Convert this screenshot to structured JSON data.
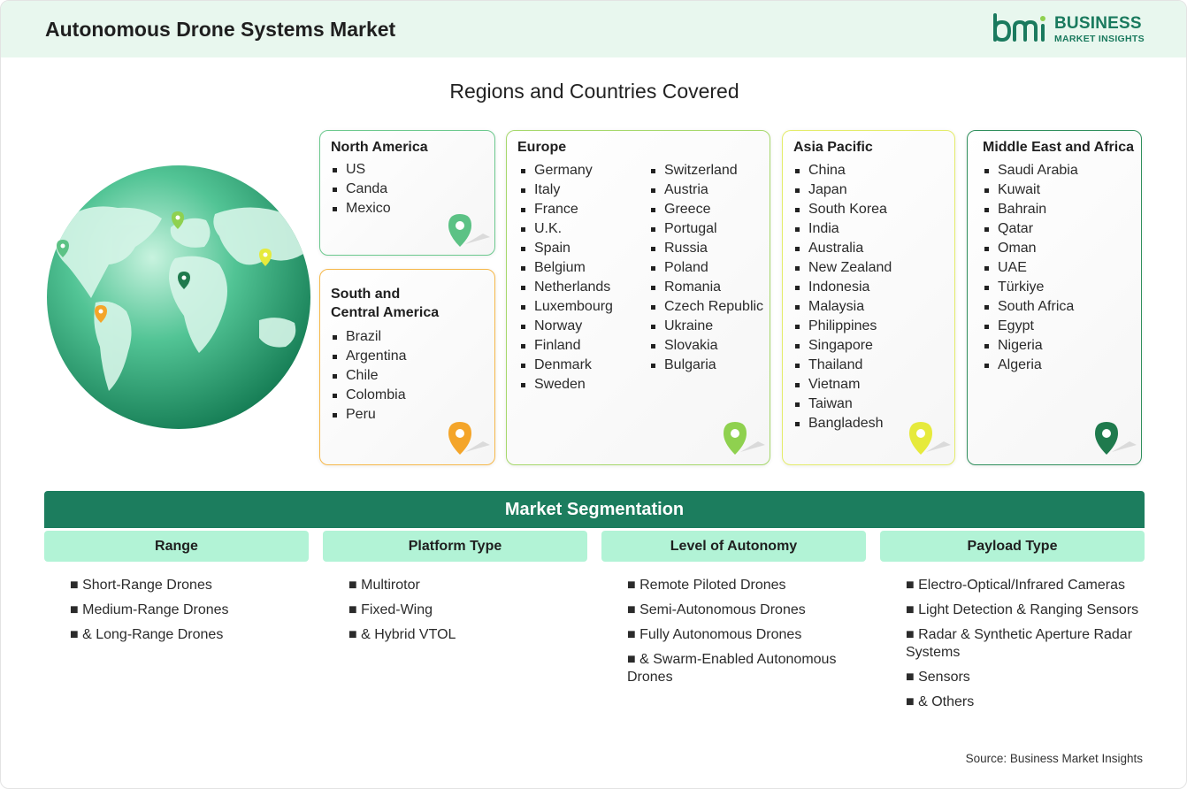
{
  "header": {
    "title": "Autonomous Drone Systems Market",
    "logo_line1": "BUSINESS",
    "logo_line2": "MARKET INSIGHTS"
  },
  "regions_title": "Regions and Countries Covered",
  "regions": {
    "north_america": {
      "title": "North America",
      "items": [
        "US",
        "Canda",
        "Mexico"
      ],
      "color": "#5cc285"
    },
    "south_central_america": {
      "title_line1": "South and",
      "title_line2": "Central America",
      "items": [
        "Brazil",
        "Argentina",
        "Chile",
        "Colombia",
        "Peru"
      ],
      "color": "#f4a52a"
    },
    "europe": {
      "title": "Europe",
      "col1": [
        "Germany",
        "Italy",
        "France",
        "U.K.",
        "Spain",
        "Belgium",
        "Netherlands",
        "Luxembourg",
        "Norway",
        "Finland",
        "Denmark",
        "Sweden"
      ],
      "col2": [
        "Switzerland",
        "Austria",
        "Greece",
        "Portugal",
        "Russia",
        "Poland",
        "Romania",
        "Czech Republic",
        "Ukraine",
        "Slovakia",
        "Bulgaria"
      ],
      "color": "#8fd14f"
    },
    "asia_pacific": {
      "title": "Asia Pacific",
      "items": [
        "China",
        "Japan",
        "South Korea",
        "India",
        "Australia",
        "New Zealand",
        "Indonesia",
        "Malaysia",
        "Philippines",
        "Singapore",
        "Thailand",
        "Vietnam",
        "Taiwan",
        "Bangladesh"
      ],
      "color": "#e6ea3c"
    },
    "middle_east_africa": {
      "title": "Middle East and Africa",
      "items": [
        "Saudi Arabia",
        "Kuwait",
        "Bahrain",
        "Qatar",
        "Oman",
        "UAE",
        "Türkiye",
        "South Africa",
        "Egypt",
        "Nigeria",
        "Algeria"
      ],
      "color": "#1f7a4d"
    }
  },
  "segmentation": {
    "title": "Market Segmentation",
    "columns": [
      {
        "heading": "Range",
        "items": [
          "■ Short-Range Drones",
          "■ Medium-Range Drones",
          "■ & Long-Range Drones"
        ]
      },
      {
        "heading": "Platform Type",
        "items": [
          "■ Multirotor",
          "■ Fixed-Wing",
          "■ & Hybrid VTOL"
        ]
      },
      {
        "heading": "Level of Autonomy",
        "items": [
          "■ Remote Piloted Drones",
          "■ Semi-Autonomous Drones",
          "■ Fully Autonomous Drones",
          "■ & Swarm-Enabled Autonomous Drones"
        ]
      },
      {
        "heading": "Payload Type",
        "items": [
          "■ Electro-Optical/Infrared Cameras",
          "■ Light Detection & Ranging Sensors",
          "■ Radar & Synthetic Aperture Radar Systems",
          "■ Sensors",
          "■ & Others"
        ]
      }
    ]
  },
  "source": "Source: Business Market Insights",
  "colors": {
    "accent": "#1c7d5e",
    "header_bg": "#e8f7ee",
    "seg_head_bg": "#b2f3d6"
  }
}
